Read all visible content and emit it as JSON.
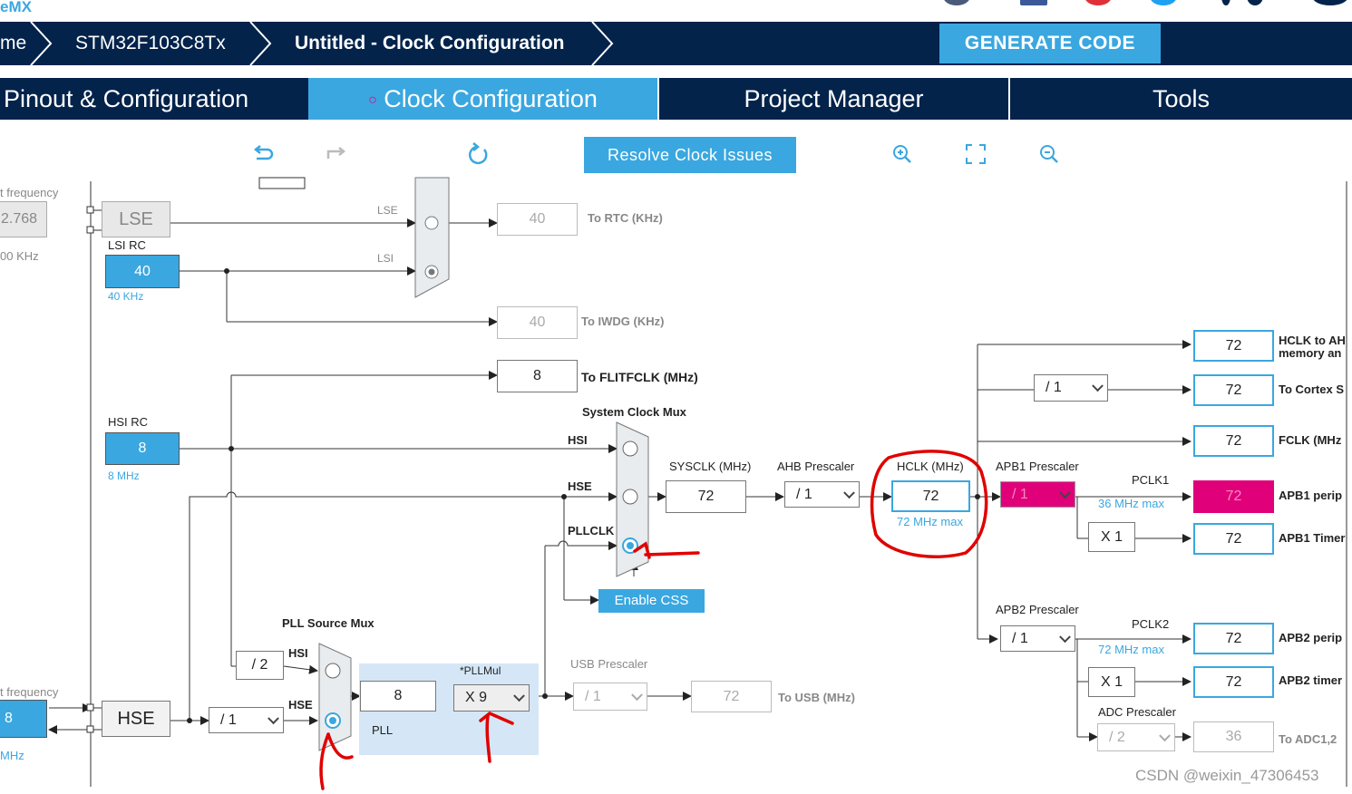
{
  "app": {
    "logo": "eMX"
  },
  "breadcrumb": {
    "home": "me",
    "chip": "STM32F103C8Tx",
    "page": "Untitled - Clock Configuration"
  },
  "actions": {
    "generate": "GENERATE CODE"
  },
  "tabs": [
    {
      "label": "Pinout & Configuration",
      "active": false
    },
    {
      "label": "Clock Configuration",
      "active": true,
      "bullet": "○"
    },
    {
      "label": "Project Manager",
      "active": false
    },
    {
      "label": "Tools",
      "active": false
    }
  ],
  "toolbar": {
    "resolve": "Resolve Clock Issues",
    "icons": [
      "undo-icon",
      "redo-icon",
      "refresh-icon",
      "zoom-in-icon",
      "fit-icon",
      "zoom-out-icon"
    ]
  },
  "left": {
    "lse_freq_label": "t frequency",
    "lse_value": "2.768",
    "lse_range": "00 KHz",
    "hse_freq_label": "t frequency",
    "hse_value": "8",
    "hse_range": "MHz"
  },
  "sources": {
    "lse": "LSE",
    "lsi_rc": "LSI RC",
    "lsi_value": "40",
    "lsi_unit": "40 KHz",
    "hsi_rc": "HSI RC",
    "hsi_value": "8",
    "hsi_unit": "8 MHz",
    "hse": "HSE"
  },
  "rtc": {
    "lse": "LSE",
    "lsi": "LSI",
    "value": "40",
    "label": "To RTC (KHz)"
  },
  "iwdg": {
    "value": "40",
    "label": "To IWDG (KHz)"
  },
  "flit": {
    "value": "8",
    "label": "To FLITFCLK (MHz)"
  },
  "sysmux": {
    "title": "System Clock Mux",
    "hsi": "HSI",
    "hse": "HSE",
    "pllclk": "PLLCLK",
    "selected": "PLLCLK"
  },
  "sysclk": {
    "label": "SYSCLK (MHz)",
    "value": "72"
  },
  "ahb": {
    "label": "AHB Prescaler",
    "value": "/ 1"
  },
  "hclk": {
    "label": "HCLK (MHz)",
    "value": "72",
    "max": "72 MHz max"
  },
  "enable_css": "Enable CSS",
  "pllsrc": {
    "title": "PLL Source Mux",
    "hsi": "HSI",
    "hse": "HSE",
    "div2": "/ 2",
    "selected": "HSE"
  },
  "hse_prediv": "/ 1",
  "pll": {
    "label": "PLL",
    "input": "8",
    "mul_label": "*PLLMul",
    "mul": "X 9"
  },
  "usb": {
    "label": "USB Prescaler",
    "prescaler": "/ 1",
    "value": "72",
    "out": "To USB (MHz)"
  },
  "apb1": {
    "label": "APB1 Prescaler",
    "value": "/ 1",
    "pclk": "PCLK1",
    "max": "36 MHz max",
    "timer_mul": "X 1"
  },
  "apb2": {
    "label": "APB2 Prescaler",
    "value": "/ 1",
    "pclk": "PCLK2",
    "max": "72 MHz max",
    "timer_mul": "X 1"
  },
  "adc": {
    "label": "ADC Prescaler",
    "value": "/ 2",
    "out": "36",
    "out_label": "To ADC1,2"
  },
  "cortex_div": "/ 1",
  "outputs": [
    {
      "value": "72",
      "label": "HCLK to AH",
      "label2": "memory an"
    },
    {
      "value": "72",
      "label": "To Cortex S"
    },
    {
      "value": "72",
      "label": "FCLK (MHz"
    },
    {
      "value": "72",
      "label": "APB1 perip"
    },
    {
      "value": "72",
      "label": "APB1 Timer"
    },
    {
      "value": "72",
      "label": "APB2 perip"
    },
    {
      "value": "72",
      "label": "APB2 timer"
    }
  ],
  "watermark": "CSDN @weixin_47306453",
  "colors": {
    "navy": "#03234b",
    "accent": "#3aa7e0",
    "error": "#e0007a",
    "annotation": "#e00000"
  }
}
